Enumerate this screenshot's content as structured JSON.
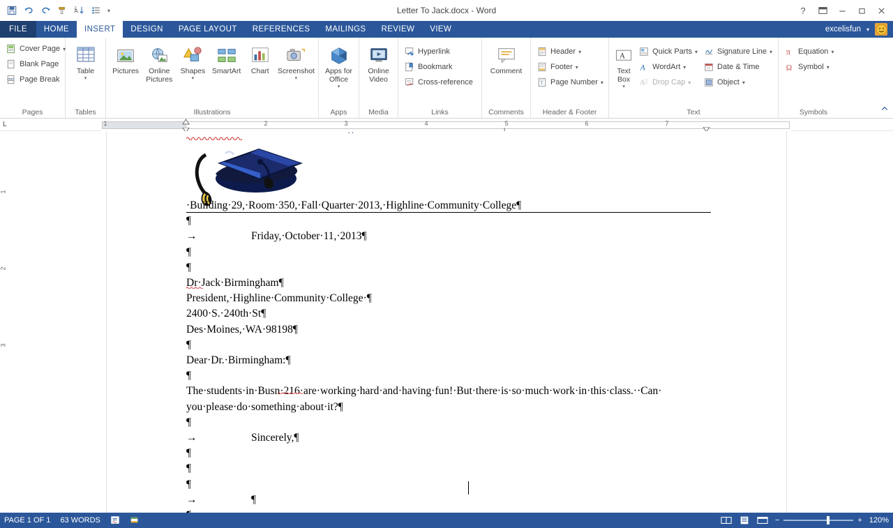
{
  "window": {
    "title": "Letter To Jack.docx - Word",
    "help_icon": "question-mark-icon",
    "ribbon_display_icon": "ribbon-display-options-icon",
    "minimize_icon": "minimize-icon",
    "restore_icon": "restore-icon",
    "close_icon": "close-icon"
  },
  "quick_access": [
    {
      "name": "save-icon",
      "glyph": "save"
    },
    {
      "name": "undo-icon",
      "glyph": "undo"
    },
    {
      "name": "redo-icon",
      "glyph": "redo"
    },
    {
      "name": "format-painter-icon",
      "glyph": "painter"
    },
    {
      "name": "sort-icon",
      "glyph": "sort"
    },
    {
      "name": "customize-quick-access-toolbar-icon",
      "glyph": "list"
    },
    {
      "name": "qat-dropdown-icon",
      "glyph": "caret"
    }
  ],
  "tabs": [
    {
      "label": "FILE",
      "active": false,
      "file": true
    },
    {
      "label": "HOME",
      "active": false
    },
    {
      "label": "INSERT",
      "active": true
    },
    {
      "label": "DESIGN",
      "active": false
    },
    {
      "label": "PAGE LAYOUT",
      "active": false
    },
    {
      "label": "REFERENCES",
      "active": false
    },
    {
      "label": "MAILINGS",
      "active": false
    },
    {
      "label": "REVIEW",
      "active": false
    },
    {
      "label": "VIEW",
      "active": false
    }
  ],
  "account": {
    "user": "excelisfun",
    "dropdown_icon": "chevron-down-icon",
    "avatar_icon": "smiley-avatar-icon"
  },
  "ribbon": {
    "groups": [
      {
        "label": "Pages",
        "items": [
          {
            "label": "Cover Page",
            "icon": "cover-page-icon",
            "dropdown": true
          },
          {
            "label": "Blank Page",
            "icon": "blank-page-icon",
            "dropdown": false
          },
          {
            "label": "Page Break",
            "icon": "page-break-icon",
            "dropdown": false
          }
        ]
      },
      {
        "label": "Tables",
        "items": [
          {
            "label": "Table",
            "icon": "table-icon",
            "dropdown": true
          }
        ]
      },
      {
        "label": "Illustrations",
        "items": [
          {
            "label": "Pictures",
            "icon": "pictures-icon",
            "dropdown": false
          },
          {
            "label": "Online Pictures",
            "icon": "online-pictures-icon",
            "dropdown": false
          },
          {
            "label": "Shapes",
            "icon": "shapes-icon",
            "dropdown": true
          },
          {
            "label": "SmartArt",
            "icon": "smartart-icon",
            "dropdown": false
          },
          {
            "label": "Chart",
            "icon": "chart-icon",
            "dropdown": false
          },
          {
            "label": "Screenshot",
            "icon": "screenshot-icon",
            "dropdown": true
          }
        ]
      },
      {
        "label": "Apps",
        "items": [
          {
            "label": "Apps for Office",
            "icon": "apps-for-office-icon",
            "dropdown": true
          }
        ]
      },
      {
        "label": "Media",
        "items": [
          {
            "label": "Online Video",
            "icon": "online-video-icon",
            "dropdown": false
          }
        ]
      },
      {
        "label": "Links",
        "items": [
          {
            "label": "Hyperlink",
            "icon": "hyperlink-icon"
          },
          {
            "label": "Bookmark",
            "icon": "bookmark-icon"
          },
          {
            "label": "Cross-reference",
            "icon": "cross-reference-icon"
          }
        ]
      },
      {
        "label": "Comments",
        "items": [
          {
            "label": "Comment",
            "icon": "comment-icon",
            "dropdown": false
          }
        ]
      },
      {
        "label": "Header & Footer",
        "items": [
          {
            "label": "Header",
            "icon": "header-icon",
            "dropdown": true
          },
          {
            "label": "Footer",
            "icon": "footer-icon",
            "dropdown": true
          },
          {
            "label": "Page Number",
            "icon": "page-number-icon",
            "dropdown": true
          }
        ]
      },
      {
        "label": "Text",
        "items": [
          {
            "label": "Text Box",
            "icon": "text-box-icon",
            "dropdown": true
          },
          {
            "label": "Quick Parts",
            "icon": "quick-parts-icon",
            "dropdown": true
          },
          {
            "label": "WordArt",
            "icon": "wordart-icon",
            "dropdown": true
          },
          {
            "label": "Drop Cap",
            "icon": "drop-cap-icon",
            "dropdown": true,
            "disabled": true
          },
          {
            "label": "Signature Line",
            "icon": "signature-line-icon",
            "dropdown": true
          },
          {
            "label": "Date & Time",
            "icon": "date-and-time-icon",
            "dropdown": false
          },
          {
            "label": "Object",
            "icon": "object-icon",
            "dropdown": true
          }
        ]
      },
      {
        "label": "Symbols",
        "items": [
          {
            "label": "Equation",
            "icon": "equation-icon",
            "dropdown": true
          },
          {
            "label": "Symbol",
            "icon": "symbol-icon",
            "dropdown": true
          }
        ]
      }
    ],
    "collapse_icon": "collapse-ribbon-icon"
  },
  "ruler": {
    "h_numbers": [
      "1",
      "2",
      "3",
      "4",
      "5",
      "6",
      "7"
    ],
    "v_numbers": [
      "1",
      "2",
      "3"
    ]
  },
  "document": {
    "lines": [
      "·Building·29,·Room·350,·Fall·Quarter·2013,·Highline·Community·College¶",
      "¶",
      "→\t\t\tFriday,·October·11,·2013¶",
      "¶",
      "¶",
      "Dr·Jack·Birmingham¶",
      "President,·Highline·Community·College·¶",
      "2400·S.·240th·St¶",
      "Des·Moines,·WA·98198¶",
      "¶",
      "Dear·Dr.·Birmingham:¶",
      "¶",
      "The·students·in·Busn·216·are·working·hard·and·having·fun!·But·there·is·so·much·work·in·this·class.··Can·",
      "you·please·do·something·about·it?¶",
      "¶",
      "→\t\t\tSincerely,¶",
      "¶",
      "¶",
      "¶",
      "→\t\t\t¶",
      "¶"
    ],
    "image_alt": "graduation-cap-clipart"
  },
  "status_bar": {
    "page": "PAGE 1 OF 1",
    "words": "63 WORDS",
    "proofing_icon": "proofing-errors-icon",
    "language_icon": "language-icon",
    "read_mode_icon": "read-mode-icon",
    "print_layout_icon": "print-layout-icon",
    "web_layout_icon": "web-layout-icon",
    "zoom_out": "−",
    "zoom_in": "+",
    "zoom_level": "120%"
  }
}
